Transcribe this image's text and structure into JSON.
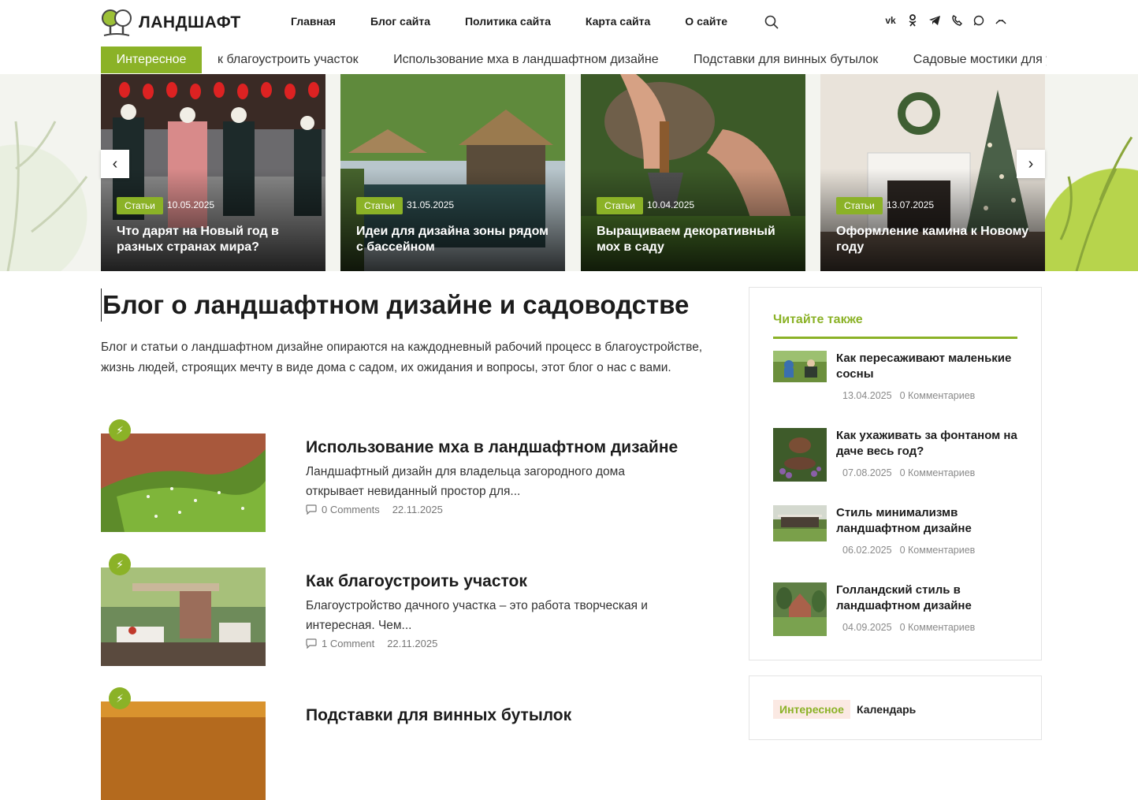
{
  "header": {
    "logo_text": "ЛАНДШАФТ",
    "nav": [
      "Главная",
      "Блог сайта",
      "Политика сайта",
      "Карта сайта",
      "О сайте"
    ],
    "socials": [
      "vk-icon",
      "odnoklassniki-icon",
      "telegram-icon",
      "viber-icon",
      "whatsapp-icon",
      "max-icon"
    ],
    "brand_color": "#8bb227"
  },
  "ticker": {
    "label": "Интересное",
    "items": [
      "к благоустроить участок",
      "Использование мха в ландшафтном дизайне",
      "Подставки для винных бутылок",
      "Садовые мостики для уча"
    ]
  },
  "slider": {
    "slides": [
      {
        "tag": "Статьи",
        "date": "10.05.2025",
        "title": "Что дарят на Новый год в разных странах мира?"
      },
      {
        "tag": "Статьи",
        "date": "31.05.2025",
        "title": "Идеи для дизайна зоны рядом с бассейном"
      },
      {
        "tag": "Статьи",
        "date": "10.04.2025",
        "title": "Выращиваем декоративный мох в саду"
      },
      {
        "tag": "Статьи",
        "date": "13.07.2025",
        "title": "Оформление камина к Новому году"
      }
    ],
    "prev": "‹",
    "next": "›"
  },
  "main": {
    "title": "Блог о ландшафтном дизайне и садоводстве",
    "intro": "Блог и статьи о ландшафтном дизайне опираются на каждодневный рабочий процесс в благоустройстве, жизнь людей, строящих мечту в виде дома с садом, их ожидания и вопросы, этот блог о нас с вами.",
    "posts": [
      {
        "title": "Использование мха в ландшафтном дизайне",
        "excerpt": "Ландшафтный дизайн для владельца загородного дома открывает невиданный простор для...",
        "comments": "0 Comments",
        "date": "22.11.2025"
      },
      {
        "title": "Как благоустроить участок",
        "excerpt": "Благоустройство дачного участка – это работа творческая и интересная. Чем...",
        "comments": "1 Comment",
        "date": "22.11.2025"
      },
      {
        "title": "Подставки для винных бутылок",
        "excerpt": "",
        "comments": "",
        "date": ""
      }
    ]
  },
  "sidebar": {
    "title": "Читайте также",
    "items": [
      {
        "title": "Как пересаживают маленькие сосны",
        "date": "13.04.2025",
        "comments": "0 Комментариев"
      },
      {
        "title": "Как ухаживать за фонтаном на даче весь год?",
        "date": "07.08.2025",
        "comments": "0 Комментариев"
      },
      {
        "title": "Стиль минимализмв ландшафтном дизайне",
        "date": "06.02.2025",
        "comments": "0 Комментариев"
      },
      {
        "title": "Голландский стиль в ландшафтном дизайне",
        "date": "04.09.2025",
        "comments": "0 Комментариев"
      }
    ],
    "tabs": [
      "Интересное",
      "Календарь"
    ]
  }
}
